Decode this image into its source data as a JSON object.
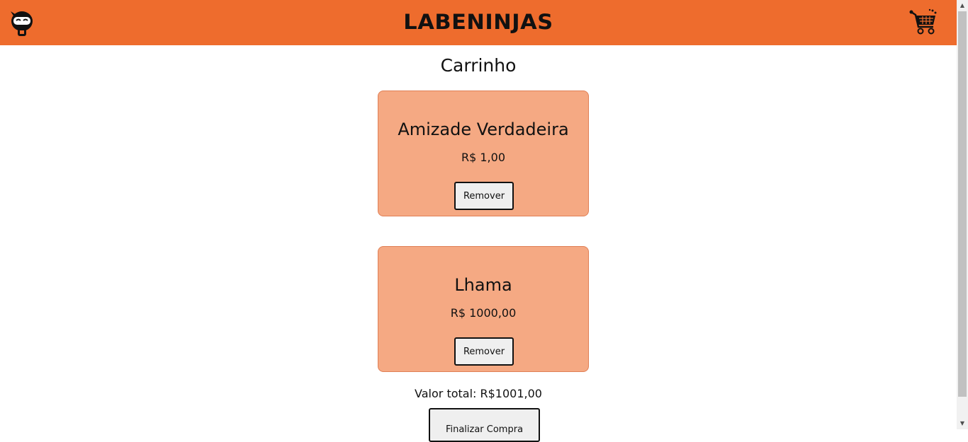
{
  "header": {
    "brand": "LABENINJAS",
    "accent_color": "#ee6c2d",
    "logo_icon": "ninja-icon",
    "cart_icon": "shopping-cart-icon"
  },
  "page": {
    "title": "Carrinho"
  },
  "cart": {
    "items": [
      {
        "title": "Amizade Verdadeira",
        "price": "R$ 1,00",
        "remove_label": "Remover"
      },
      {
        "title": "Lhama",
        "price": "R$ 1000,00",
        "remove_label": "Remover"
      }
    ],
    "total": "Valor total: R$1001,00",
    "finish_label": "Finalizar Compra",
    "card_color": "#f5a983"
  }
}
